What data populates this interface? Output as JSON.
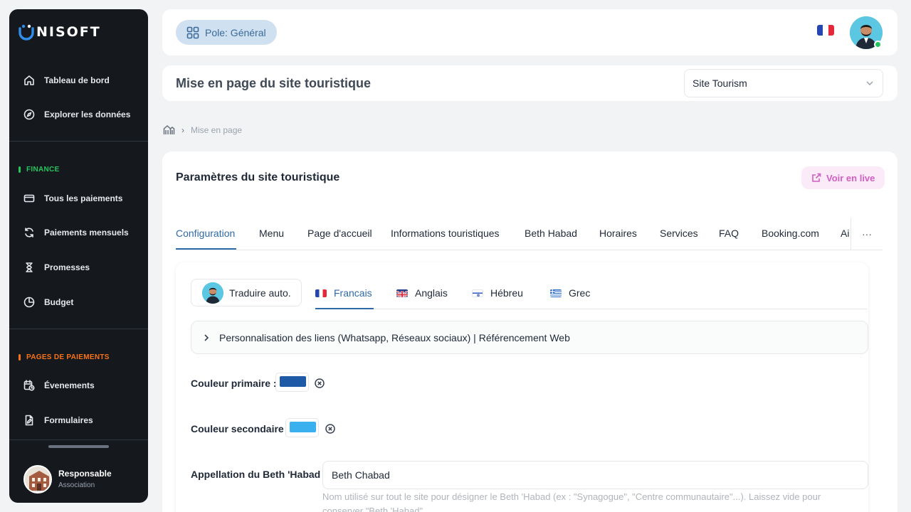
{
  "sidebar": {
    "brand": "NISOFT",
    "items": [
      {
        "label": "Tableau de bord",
        "icon": "home-icon"
      },
      {
        "label": "Explorer les données",
        "icon": "compass-icon"
      }
    ],
    "finance_label": "FINANCE",
    "finance_color": "#22c55e",
    "finance_items": [
      {
        "label": "Tous les paiements",
        "icon": "credit-card-icon"
      },
      {
        "label": "Paiements mensuels",
        "icon": "refresh-icon"
      },
      {
        "label": "Promesses",
        "icon": "hourglass-icon"
      },
      {
        "label": "Budget",
        "icon": "pie-chart-icon"
      }
    ],
    "payments_label": "PAGES DE PAIEMENTS",
    "payments_color": "#f97316",
    "payments_items": [
      {
        "label": "Évenements",
        "icon": "calendar-clock-icon"
      },
      {
        "label": "Formulaires",
        "icon": "document-edit-icon"
      }
    ],
    "user": {
      "name": "Responsable",
      "role": "Association"
    }
  },
  "topbar": {
    "pole_label": "Pole: Général",
    "language_flag": "flag-fr-icon"
  },
  "titlebar": {
    "title": "Mise en page du site touristique",
    "site_select_value": "Site Tourism"
  },
  "breadcrumb": {
    "current": "Mise en page"
  },
  "card": {
    "title": "Paramètres du site touristique",
    "live_button": "Voir en live",
    "tabs": [
      "Configuration",
      "Menu",
      "Page d'accueil",
      "Informations touristiques",
      "Beth Habad",
      "Horaires",
      "Services",
      "FAQ",
      "Booking.com",
      "Ai"
    ],
    "active_tab": "Configuration",
    "more_label": "···"
  },
  "config": {
    "translate_button": "Traduire auto.",
    "languages": [
      {
        "label": "Francais",
        "flag": "flag-fr-icon"
      },
      {
        "label": "Anglais",
        "flag": "flag-uk-icon"
      },
      {
        "label": "Hébreu",
        "flag": "flag-il-icon"
      },
      {
        "label": "Grec",
        "flag": "flag-gr-icon"
      }
    ],
    "active_language": "Francais",
    "collapse_title": "Personnalisation des liens (Whatsapp, Réseaux sociaux) | Référencement Web",
    "primary_color_label": "Couleur primaire :",
    "primary_color": "#1f5aa6",
    "secondary_color_label": "Couleur secondaire :",
    "secondary_color": "#3ab0ee",
    "beth_label": "Appellation du Beth 'Habad :",
    "beth_value": "Beth Chabad",
    "beth_help": "Nom utilisé sur tout le site pour désigner le Beth 'Habad (ex : \"Synagogue\", \"Centre communautaire\"...). Laissez vide pour conserver \"Beth 'Habad\"."
  }
}
